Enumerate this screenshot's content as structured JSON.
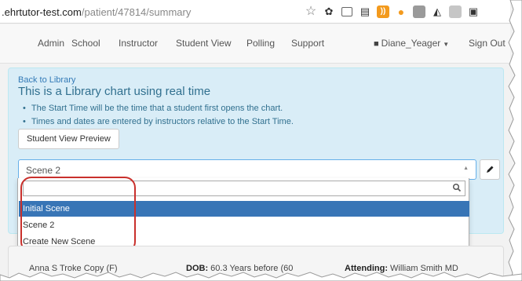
{
  "browser": {
    "url_domain": ".ehrtutor-test.com",
    "url_path": "/patient/47814/summary",
    "extension_icons": [
      "star-icon",
      "extension-icon-1",
      "cast-icon",
      "news-icon",
      "rss-icon",
      "dots-icon",
      "extension-icon-2",
      "extension-icon-3",
      "extension-icon-4",
      "menu-icon"
    ]
  },
  "nav": {
    "items": [
      "Admin",
      "School",
      "Instructor",
      "Student View",
      "Polling",
      "Support"
    ],
    "user": "Diane_Yeager",
    "signout": "Sign Out"
  },
  "panel": {
    "back_link": "Back to Library",
    "title": "This is a Library chart using real time",
    "bullets": [
      "The Start Time will be the time that a student first opens the chart.",
      "Times and dates are entered by instructors relative to the Start Time."
    ],
    "preview_button": "Student View Preview",
    "scene_selected": "Scene 2"
  },
  "dropdown": {
    "search_placeholder": "",
    "options": [
      "Initial Scene",
      "Scene 2",
      "Create New Scene"
    ],
    "highlighted_option": "Initial Scene"
  },
  "patient": {
    "name": "Anna S Troke Copy (F)",
    "dob_label": "DOB:",
    "dob_value": "60.3 Years before",
    "dob_extra": "(60",
    "attending_label": "Attending:",
    "attending_value": "William Smith MD"
  },
  "colors": {
    "panel_bg": "#d9edf7",
    "panel_text": "#31708f",
    "highlight": "#3875b6",
    "annotation": "#c9302c"
  }
}
